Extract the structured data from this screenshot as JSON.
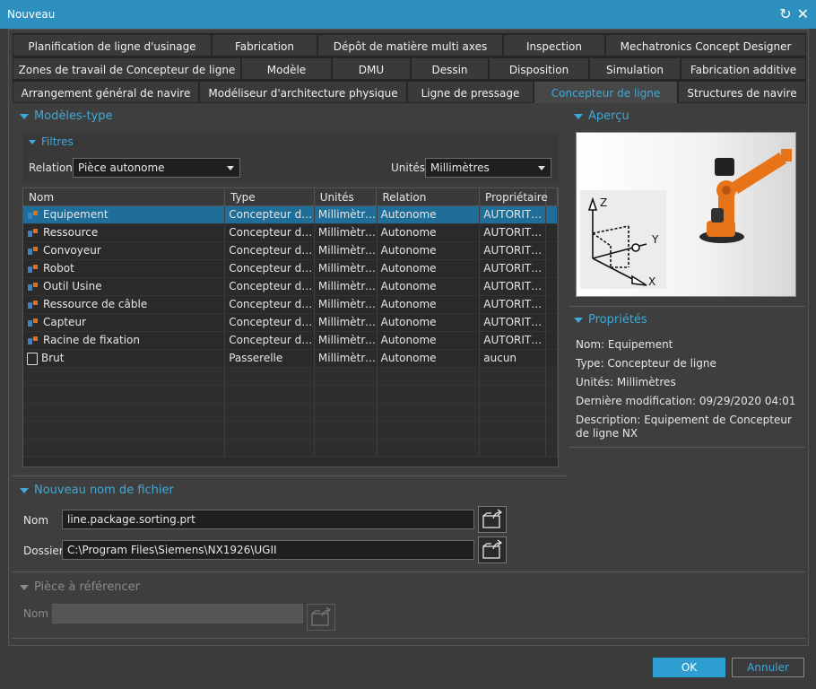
{
  "window": {
    "title": "Nouveau"
  },
  "tabs": {
    "row1": [
      "Planification de ligne d'usinage",
      "Fabrication",
      "Dépôt de matière multi axes",
      "Inspection",
      "Mechatronics Concept Designer"
    ],
    "row2": [
      "Zones de travail de Concepteur de ligne",
      "Modèle",
      "DMU",
      "Dessin",
      "Disposition",
      "Simulation",
      "Fabrication additive"
    ],
    "row3": [
      "Arrangement général de navire",
      "Modéliseur d'architecture physique",
      "Ligne de pressage",
      "Concepteur de ligne",
      "Structures de navire"
    ],
    "active": "Concepteur de ligne"
  },
  "templates": {
    "heading": "Modèles-type",
    "filters_heading": "Filtres",
    "relation_label": "Relation",
    "relation_value": "Pièce autonome",
    "units_label": "Unités",
    "units_value": "Millimètres",
    "columns": [
      "Nom",
      "Type",
      "Unités",
      "Relation",
      "Propriétaire"
    ],
    "rows": [
      {
        "icon": "part-icon",
        "name": "Equipement",
        "type": "Concepteur de ...",
        "units": "Millimètres",
        "relation": "Autonome",
        "owner": "AUTORITE ...",
        "selected": true
      },
      {
        "icon": "part-icon",
        "name": "Ressource",
        "type": "Concepteur de ...",
        "units": "Millimètres",
        "relation": "Autonome",
        "owner": "AUTORITE ..."
      },
      {
        "icon": "part-icon",
        "name": "Convoyeur",
        "type": "Concepteur de ...",
        "units": "Millimètres",
        "relation": "Autonome",
        "owner": "AUTORITE ..."
      },
      {
        "icon": "part-icon",
        "name": "Robot",
        "type": "Concepteur de ...",
        "units": "Millimètres",
        "relation": "Autonome",
        "owner": "AUTORITE ..."
      },
      {
        "icon": "part-icon",
        "name": "Outil Usine",
        "type": "Concepteur de ...",
        "units": "Millimètres",
        "relation": "Autonome",
        "owner": "AUTORITE ..."
      },
      {
        "icon": "part-icon",
        "name": "Ressource de câble",
        "type": "Concepteur de ...",
        "units": "Millimètres",
        "relation": "Autonome",
        "owner": "AUTORITE ..."
      },
      {
        "icon": "part-icon",
        "name": "Capteur",
        "type": "Concepteur de ...",
        "units": "Millimètres",
        "relation": "Autonome",
        "owner": "AUTORITE ..."
      },
      {
        "icon": "part-icon",
        "name": "Racine de fixation",
        "type": "Concepteur de ...",
        "units": "Millimètres",
        "relation": "Autonome",
        "owner": "AUTORITE ..."
      },
      {
        "icon": "document-icon",
        "name": "Brut",
        "type": "Passerelle",
        "units": "Millimètres",
        "relation": "Autonome",
        "owner": "aucun"
      }
    ]
  },
  "preview": {
    "heading": "Aperçu"
  },
  "properties": {
    "heading": "Propriétés",
    "name": "Nom: Equipement",
    "type": "Type: Concepteur de ligne",
    "units": "Unités: Millimètres",
    "modified": "Dernière modification: 09/29/2020 04:01",
    "description": "Description: Equipement de Concepteur de ligne NX"
  },
  "new_file": {
    "heading": "Nouveau nom de fichier",
    "name_label": "Nom",
    "name_value": "line.package.sorting.prt",
    "folder_label": "Dossier",
    "folder_value": "C:\\Program Files\\Siemens\\NX1926\\UGII"
  },
  "reference": {
    "heading": "Pièce à référencer",
    "name_label": "Nom",
    "name_value": ""
  },
  "buttons": {
    "ok": "OK",
    "cancel": "Annuler"
  },
  "colors": {
    "accent": "#3fa9d9",
    "titlebar": "#2d8fbd",
    "selection": "#1e6e99",
    "robot": "#e8741a"
  }
}
